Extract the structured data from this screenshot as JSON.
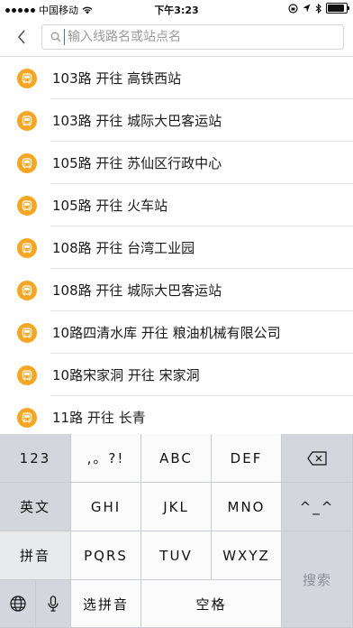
{
  "status_bar": {
    "carrier": "中国移动",
    "time": "下午3:23",
    "battery_level": 0.95
  },
  "header": {
    "back_icon": "chevron-left-icon",
    "search_icon": "search-icon",
    "search_placeholder": "输入线路名或站点名",
    "search_value": ""
  },
  "results": [
    {
      "text": "103路 开往 高铁西站",
      "icon": "bus-icon"
    },
    {
      "text": "103路 开往 城际大巴客运站",
      "icon": "bus-icon"
    },
    {
      "text": "105路 开往 苏仙区行政中心",
      "icon": "bus-icon"
    },
    {
      "text": "105路 开往 火车站",
      "icon": "bus-icon"
    },
    {
      "text": "108路 开往 台湾工业园",
      "icon": "bus-icon"
    },
    {
      "text": "108路 开往 城际大巴客运站",
      "icon": "bus-icon"
    },
    {
      "text": "10路四清水库 开往 粮油机械有限公司",
      "icon": "bus-icon"
    },
    {
      "text": "10路宋家洞 开往 宋家洞",
      "icon": "bus-icon"
    },
    {
      "text": "11路 开往 长青",
      "icon": "bus-icon"
    }
  ],
  "keyboard": {
    "k_123": "123",
    "k_punct": ",。?!",
    "k_abc": "ABC",
    "k_def": "DEF",
    "k_delete_icon": "backspace-icon",
    "k_english": "英文",
    "k_ghi": "GHI",
    "k_jkl": "JKL",
    "k_mno": "MNO",
    "k_emoticon": "^_^",
    "k_pinyin": "拼音",
    "k_pqrs": "PQRS",
    "k_tuv": "TUV",
    "k_wxyz": "WXYZ",
    "k_search": "搜索",
    "k_globe_icon": "globe-icon",
    "k_mic_icon": "microphone-icon",
    "k_select_pinyin": "选拼音",
    "k_space": "空格"
  },
  "colors": {
    "accent_orange": "#f5a623",
    "keyboard_bg": "#d3d6dc"
  }
}
